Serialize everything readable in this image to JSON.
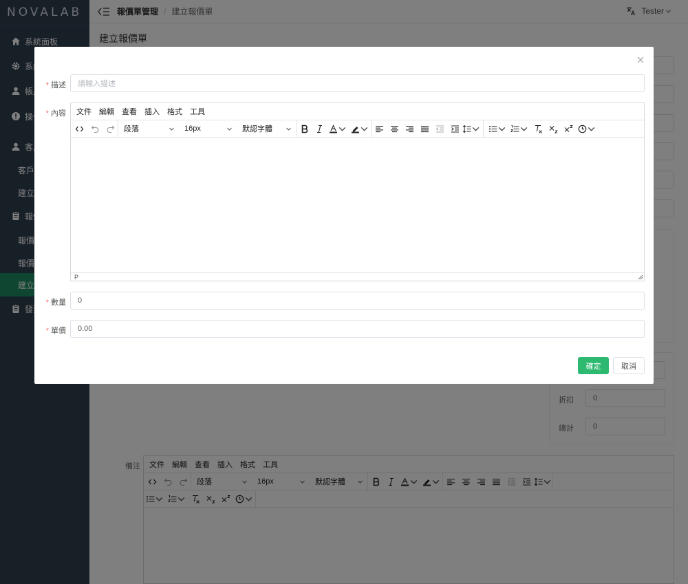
{
  "app": {
    "logo": "NOVALAB"
  },
  "sidebar": {
    "items": [
      {
        "label": "系統面板",
        "icon": "home-icon"
      },
      {
        "label": "系統設定",
        "icon": "gear-icon"
      },
      {
        "label": "帳戶管理",
        "icon": "user-icon"
      },
      {
        "label": "操作記錄",
        "icon": "info-icon"
      },
      {
        "label": "客戶管理",
        "icon": "user-icon"
      },
      {
        "label": "客戶列表",
        "icon": ""
      },
      {
        "label": "建立客戶",
        "icon": ""
      },
      {
        "label": "報價單管理",
        "icon": "clipboard-icon"
      },
      {
        "label": "報價單列表",
        "icon": ""
      },
      {
        "label": "報價單詳情",
        "icon": ""
      },
      {
        "label": "建立報價單",
        "icon": ""
      },
      {
        "label": "發票管理",
        "icon": "clipboard-icon"
      }
    ]
  },
  "header": {
    "breadcrumb": [
      "報價單管理",
      "建立報價單"
    ],
    "user": "Tester"
  },
  "page": {
    "title": "建立報價單",
    "totals": {
      "discount_label": "折扣",
      "discount_value": "0",
      "total_label": "總計",
      "total_value": "0"
    },
    "remarks_label": "備注"
  },
  "editor": {
    "menu": [
      "文件",
      "編輯",
      "查看",
      "插入",
      "格式",
      "工具"
    ],
    "block_format": "段落",
    "font_size": "16px",
    "font_family": "默認字體",
    "status_path": "P"
  },
  "modal": {
    "description_label": "描述",
    "description_placeholder": "請輸入描述",
    "content_label": "內容",
    "quantity_label": "數量",
    "quantity_value": "0",
    "unit_price_label": "單價",
    "unit_price_value": "0.00",
    "confirm_label": "確定",
    "cancel_label": "取消"
  },
  "colors": {
    "sidebar_bg": "#2f3f4f",
    "active_item": "#1f8c63",
    "primary_button": "#2db96f",
    "required_star": "#f56c6c"
  }
}
